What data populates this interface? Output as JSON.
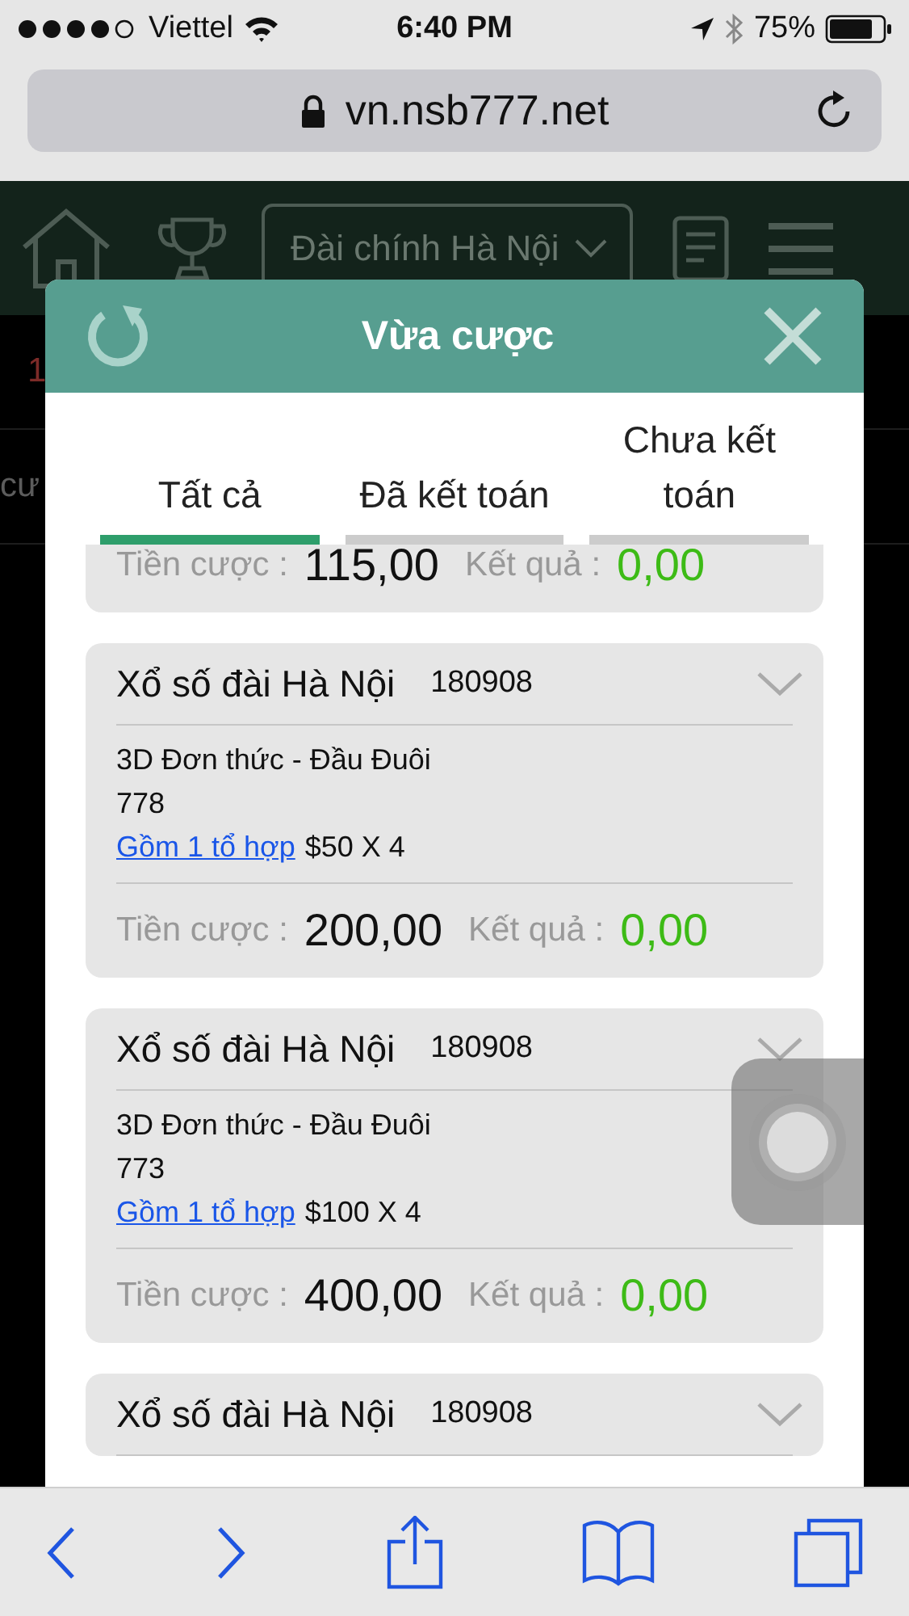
{
  "status_bar": {
    "carrier": "Viettel",
    "time": "6:40 PM",
    "battery": "75%"
  },
  "browser": {
    "url": "vn.nsb777.net"
  },
  "site_header": {
    "station_dropdown": "Đài chính Hà Nội"
  },
  "background": {
    "number": "1",
    "text": "cư"
  },
  "modal": {
    "title": "Vừa cược",
    "tabs": [
      {
        "label": "Tất cả",
        "selected": true
      },
      {
        "label": "Đã kết toán",
        "selected": false
      },
      {
        "label": "Chưa kết toán",
        "selected": false
      }
    ],
    "bets": [
      {
        "kind": "footer_only",
        "stake_label": "Tiền cược :",
        "stake": "115,00",
        "result_label": "Kết quả :",
        "result": "0,00"
      },
      {
        "kind": "full",
        "lottery": "Xổ số đài Hà Nội",
        "draw": "180908",
        "bet_type": "3D Đơn thức - Đầu Đuôi",
        "numbers": "778",
        "combo_link": "Gồm 1 tổ hợp",
        "stake_detail": "$50 X 4",
        "stake_label": "Tiền cược :",
        "stake": "200,00",
        "result_label": "Kết quả :",
        "result": "0,00"
      },
      {
        "kind": "full",
        "lottery": "Xổ số đài Hà Nội",
        "draw": "180908",
        "bet_type": "3D Đơn thức - Đầu Đuôi",
        "numbers": "773",
        "combo_link": "Gồm 1 tổ hợp",
        "stake_detail": "$100 X 4",
        "stake_label": "Tiền cược :",
        "stake": "400,00",
        "result_label": "Kết quả :",
        "result": "0,00"
      },
      {
        "kind": "full",
        "lottery": "Xổ số đài Hà Nội",
        "draw": "180908"
      }
    ]
  }
}
